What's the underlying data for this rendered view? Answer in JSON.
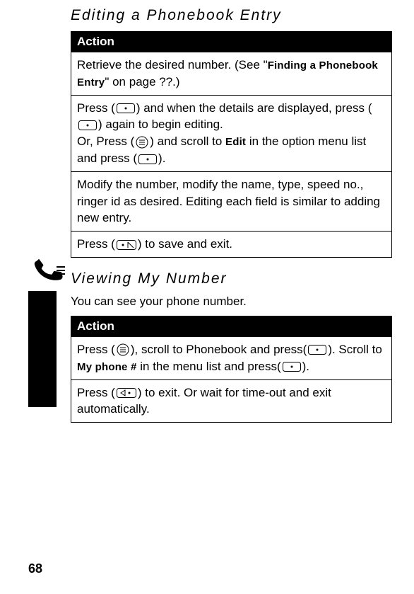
{
  "sidebar": {
    "label": "Phonebook"
  },
  "section1": {
    "title": "Editing a Phonebook Entry",
    "header": "Action",
    "rows": [
      {
        "pre": "Retrieve the desired number. (See \"",
        "bold": "Finding a Phonebook Entry",
        "post": "\" on page ??.)"
      },
      {
        "line1a": "Press (",
        "line1b": ") and when the details are displayed, press (",
        "line1c": ") again to begin editing.",
        "line2a": "Or, Press (",
        "line2b": ") and scroll to ",
        "bold2": "Edit",
        "line2c": " in the option menu list and press (",
        "line2d": ")."
      },
      {
        "text": "Modify the number, modify the name, type, speed no., ringer id as desired. Editing each field is similar to adding new entry."
      },
      {
        "pre": "Press (",
        "post": ") to save and exit."
      }
    ]
  },
  "section2": {
    "title": "Viewing My Number",
    "intro": "You can see your phone number.",
    "header": "Action",
    "rows": [
      {
        "a": "Press (",
        "b": "), scroll to Phonebook and press(",
        "c": "). Scroll to ",
        "bold": "My phone #",
        "d": " in the menu list and press(",
        "e": ")."
      },
      {
        "a": "Press (",
        "b": ") to exit. Or wait for time-out and exit automatically."
      }
    ]
  },
  "page_number": "68"
}
